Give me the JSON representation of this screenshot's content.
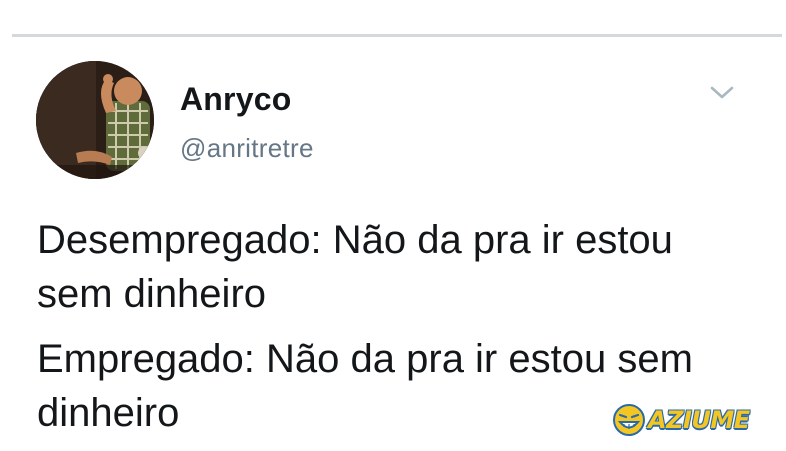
{
  "tweet": {
    "author": {
      "name": "Anryco",
      "handle": "@anritretre"
    },
    "text": {
      "line1": "Desempregado: Não da pra ir estou sem dinheiro",
      "line2": "Empregado: Não da pra ir estou sem dinheiro"
    },
    "menu_icon": "chevron-down-icon"
  },
  "watermark": {
    "text": "AZIUME"
  },
  "colors": {
    "text": "#14171a",
    "handle": "#657786",
    "divider": "#d6d9dc",
    "chevron": "#aab8c2",
    "watermark_fill": "#f3c623",
    "watermark_outline": "#2b6aa8"
  }
}
